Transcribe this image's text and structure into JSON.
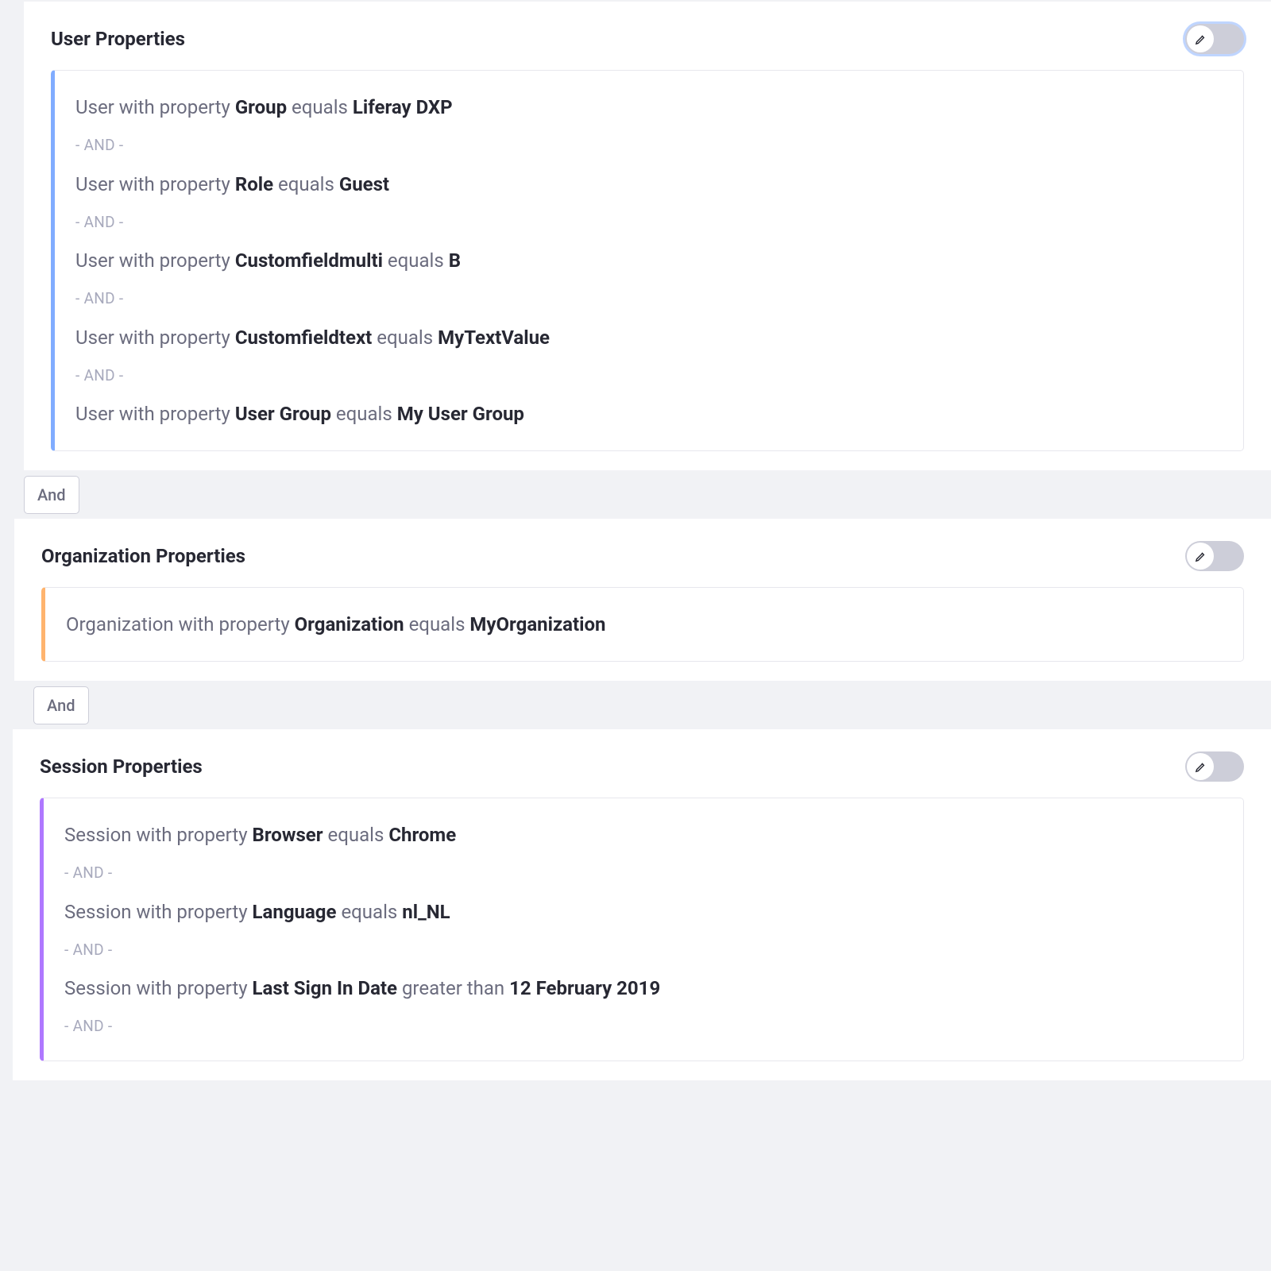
{
  "sections": [
    {
      "title": "User Properties",
      "focused": true,
      "colorClass": "blue",
      "rules": [
        {
          "prefix": "User with property",
          "property": "Group",
          "operator": "equals",
          "value": "Liferay DXP"
        },
        {
          "prefix": "User with property",
          "property": "Role",
          "operator": "equals",
          "value": "Guest"
        },
        {
          "prefix": "User with property",
          "property": "Customfieldmulti",
          "operator": "equals",
          "value": "B"
        },
        {
          "prefix": "User with property",
          "property": "Customfieldtext",
          "operator": "equals",
          "value": "MyTextValue"
        },
        {
          "prefix": "User with property",
          "property": "User Group",
          "operator": "equals",
          "value": "My User Group"
        }
      ]
    },
    {
      "title": "Organization Properties",
      "focused": false,
      "colorClass": "orange",
      "rules": [
        {
          "prefix": "Organization with property",
          "property": "Organization",
          "operator": "equals",
          "value": "MyOrganization"
        }
      ]
    },
    {
      "title": "Session Properties",
      "focused": false,
      "colorClass": "purple",
      "rules": [
        {
          "prefix": "Session with property",
          "property": "Browser",
          "operator": "equals",
          "value": "Chrome"
        },
        {
          "prefix": "Session with property",
          "property": "Language",
          "operator": "equals",
          "value": "nl_NL"
        },
        {
          "prefix": "Session with property",
          "property": "Last Sign In Date",
          "operator": "greater than",
          "value": "12 February 2019"
        },
        null
      ]
    }
  ],
  "andSepText": "- AND -",
  "betweenButtons": [
    "And",
    "And"
  ]
}
